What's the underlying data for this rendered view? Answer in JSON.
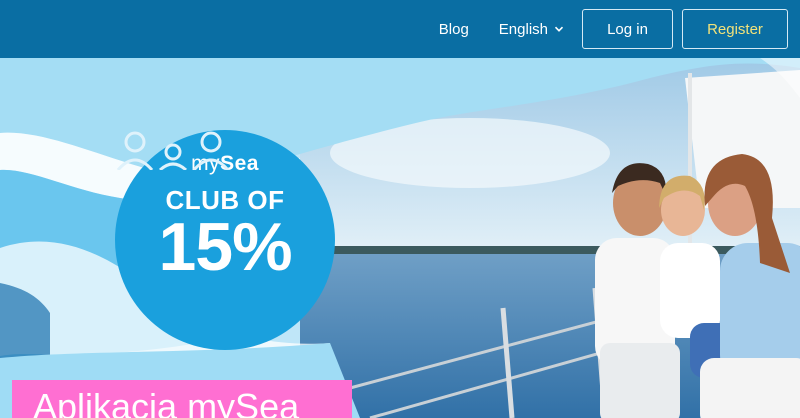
{
  "nav": {
    "blog": "Blog",
    "language": "English",
    "login": "Log in",
    "register": "Register"
  },
  "badge": {
    "brand_prefix": "my",
    "brand_suffix": "Sea",
    "club": "CLUB OF",
    "percent": "15%"
  },
  "caption": "Aplikacja mySea",
  "icons": {
    "language_caret": "chevron-down-icon",
    "club_members": "people-icon"
  },
  "colors": {
    "navbar": "#0a6ea3",
    "badge": "#1aa0dd",
    "caption_bg": "#ff6fd2",
    "register_text": "#f1e27a"
  }
}
